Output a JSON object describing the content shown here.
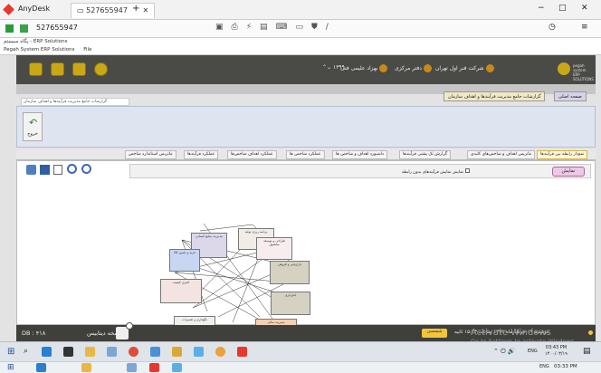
{
  "anydesk": {
    "app_name": "AnyDesk",
    "tab_label": "527655947",
    "address": "527655947",
    "new_tab": "+"
  },
  "window": {
    "title": "پگاه سیستم - ERP Solutions",
    "menu": "Pegah System ERP Solutions",
    "file_menu": "File"
  },
  "header": {
    "company": "شرکت فنر اول تهران",
    "office": "دفتر مرکزی",
    "user": "بهزاد علیمی فنی",
    "year": "۱۳۹۹",
    "logo_line1": "pegah system",
    "logo_line2": "ERP SOLUTIONS"
  },
  "page_tabs": {
    "home": "صفحه اصلی",
    "report": "گزارشات جامع مدیریت فرآیندها و اهداف سازمان"
  },
  "breadcrumb": "گزارشات جامع مدیریت فرآیندها و اهداف سازمان",
  "toolbar": {
    "exit_label": "خروج"
  },
  "sub_tabs": [
    "نمودار رابطه بین فرآیندها",
    "ماتریس اهداف و شاخص‌های کلیدی",
    "گزارش تک پشتی فرآیندها",
    "داشبورد اهداف و شاخص ها",
    "عملکرد شاخص ها",
    "عملکرد اهداف شاخص‌ها",
    "عملکرد فرآیندها",
    "ماتریس استاندارد شاخص"
  ],
  "content": {
    "show_button": "نمایش",
    "checkbox_label": "نمایش نمایش فرآیندهای بدون رابطه"
  },
  "nodes": [
    "مدیریت منابع انسانی",
    "برنامه ریزی تولید",
    "طراحی و توسعه محصول",
    "خرید و تامین کالا",
    "بازاریابی و فروش",
    "کنترل کیفیت",
    "انبارداری",
    "نگهداری و تعمیرات",
    "مدیریت مالی",
    "خدمات پس از فروش"
  ],
  "status": {
    "datetime": "دوشنبه ۱۹ خرداد ماه ۱۳۹۹  ساعت ۱۵:۴۳  ثانیه",
    "shamsi": "شمسی",
    "version_label": "نسخه دیتابیس :",
    "db_label": "DB : ۴۱۸",
    "watermark_title": "Activate Windows",
    "watermark_sub": "Go to Settings to activate Windows."
  },
  "clock1": {
    "time": "03:43 PM",
    "date": "۱۴۰۰/۰۳/۱۹",
    "lang": "ENG"
  },
  "clock2": {
    "time": "03:33 PM",
    "lang": "ENG"
  }
}
